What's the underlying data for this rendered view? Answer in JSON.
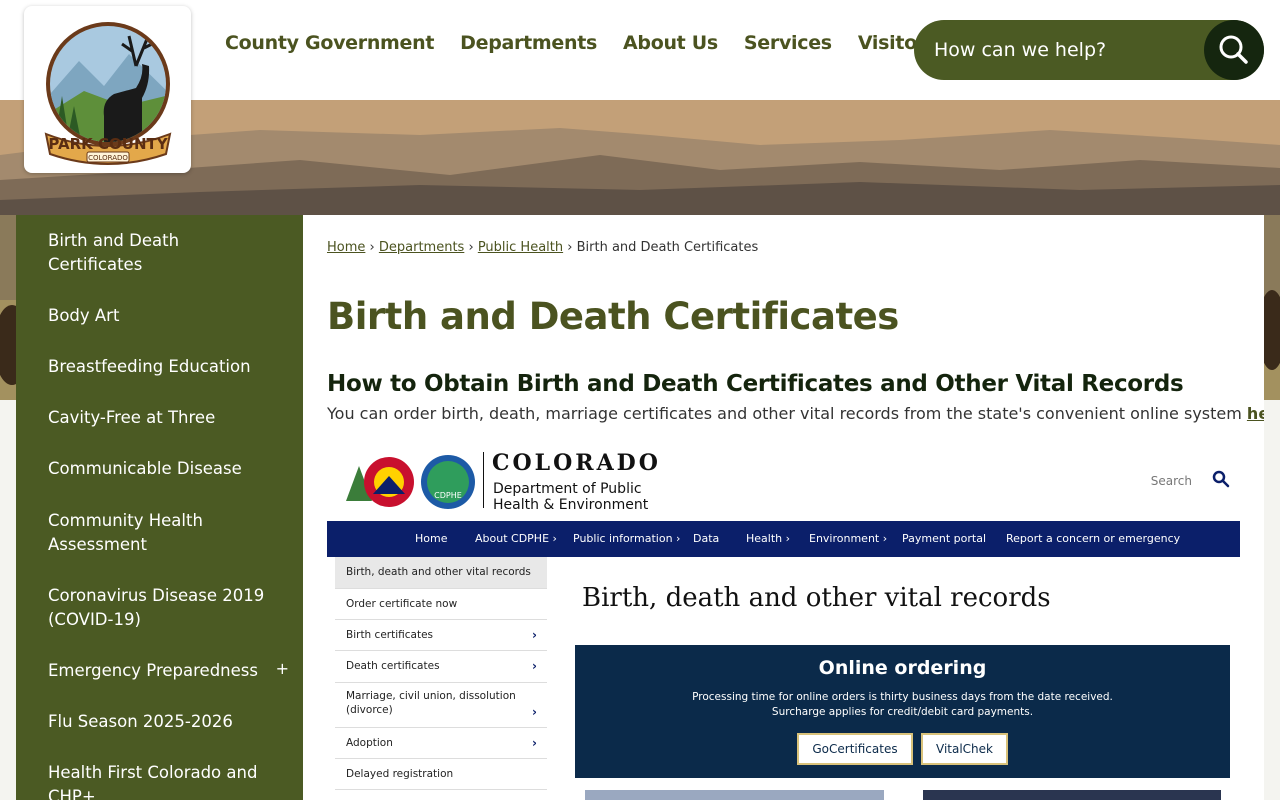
{
  "header": {
    "logo_text": "PARK COUNTY",
    "logo_subtext": "COLORADO",
    "nav": [
      "County Government",
      "Departments",
      "About Us",
      "Services",
      "Visitors"
    ],
    "search_placeholder": "How can we help?",
    "search_icon": "search-icon"
  },
  "sidebar": {
    "items": [
      {
        "label": "Birth and Death Certificates"
      },
      {
        "label": "Body Art"
      },
      {
        "label": "Breastfeeding Education"
      },
      {
        "label": "Cavity-Free at Three"
      },
      {
        "label": "Communicable Disease"
      },
      {
        "label": "Community Health Assessment"
      },
      {
        "label": "Coronavirus Disease 2019 (COVID-19)"
      },
      {
        "label": "Emergency Preparedness",
        "expand": "+"
      },
      {
        "label": "Flu Season 2025-2026"
      },
      {
        "label": "Health First Colorado and CHP+"
      }
    ]
  },
  "breadcrumb": {
    "items": [
      "Home",
      "Departments",
      "Public Health"
    ],
    "current": "Birth and Death Certificates",
    "separator": "›"
  },
  "main": {
    "title": "Birth and Death Certificates",
    "heading": "How to Obtain Birth and Death Certificates and Other Vital Records",
    "text_before": "You can order birth, death, marriage certificates and other vital records from the state's convenient online system ",
    "link": "here",
    "text_after": "."
  },
  "embedded": {
    "wordmark": "COLORADO",
    "dept_line1": "Department of Public",
    "dept_line2": "Health & Environment",
    "seal_text": "CDPHE",
    "search_label": "Search",
    "nav": [
      "Home",
      "About CDPHE ›",
      "Public information ›",
      "Data",
      "Health ›",
      "Environment ›",
      "Payment portal",
      "Report a concern or emergency"
    ],
    "side": [
      {
        "label": "Birth, death and other vital records",
        "chev": ""
      },
      {
        "label": "Order certificate now",
        "chev": ""
      },
      {
        "label": "Birth certificates",
        "chev": "›"
      },
      {
        "label": "Death certificates",
        "chev": "›"
      },
      {
        "label": "Marriage, civil union, dissolution (divorce)",
        "chev": "›"
      },
      {
        "label": "Adoption",
        "chev": "›"
      },
      {
        "label": "Delayed registration",
        "chev": ""
      }
    ],
    "heading": "Birth, death and other vital records",
    "box_title": "Online ordering",
    "box_line1": "Processing time for online orders is thirty business days from the date received.",
    "box_line2": "Surcharge applies for credit/debit card payments.",
    "buttons": [
      "GoCertificates",
      "VitalChek"
    ]
  },
  "colors": {
    "brand_olive": "#4b5a23",
    "brand_dark": "#15260f",
    "cdphe_navy": "#0b1f6a"
  }
}
